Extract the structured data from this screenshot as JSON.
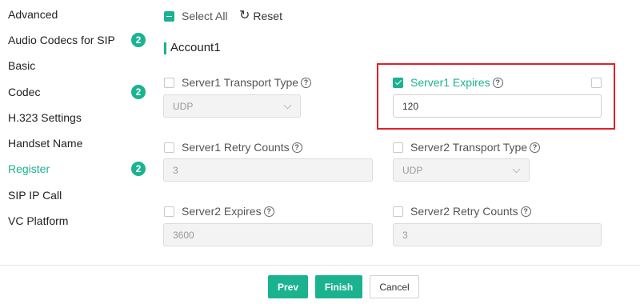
{
  "sidebar": {
    "items": [
      {
        "label": "Advanced",
        "badge": ""
      },
      {
        "label": "Audio Codecs for SIP",
        "badge": "2"
      },
      {
        "label": "Basic",
        "badge": ""
      },
      {
        "label": "Codec",
        "badge": "2"
      },
      {
        "label": "H.323 Settings",
        "badge": ""
      },
      {
        "label": "Handset Name",
        "badge": ""
      },
      {
        "label": "Register",
        "badge": "2",
        "active": true
      },
      {
        "label": "SIP IP Call",
        "badge": ""
      },
      {
        "label": "VC Platform",
        "badge": ""
      }
    ]
  },
  "toolbar": {
    "select_all": "Select All",
    "reset": "Reset",
    "reset_icon": "refresh-icon"
  },
  "section": {
    "title": "Account1"
  },
  "fields": {
    "server1_transport": {
      "label": "Server1 Transport Type",
      "value": "UDP",
      "checked": false
    },
    "server1_expires": {
      "label": "Server1 Expires",
      "value": "120",
      "checked": true
    },
    "server1_retry": {
      "label": "Server1 Retry Counts",
      "value": "3",
      "checked": false
    },
    "server2_transport": {
      "label": "Server2 Transport Type",
      "value": "UDP",
      "checked": false
    },
    "server2_expires": {
      "label": "Server2 Expires",
      "value": "3600",
      "checked": false
    },
    "server2_retry": {
      "label": "Server2 Retry Counts",
      "value": "3",
      "checked": false
    }
  },
  "footer": {
    "prev": "Prev",
    "finish": "Finish",
    "cancel": "Cancel"
  },
  "colors": {
    "accent": "#1bb38f",
    "highlight": "#e0202a"
  }
}
